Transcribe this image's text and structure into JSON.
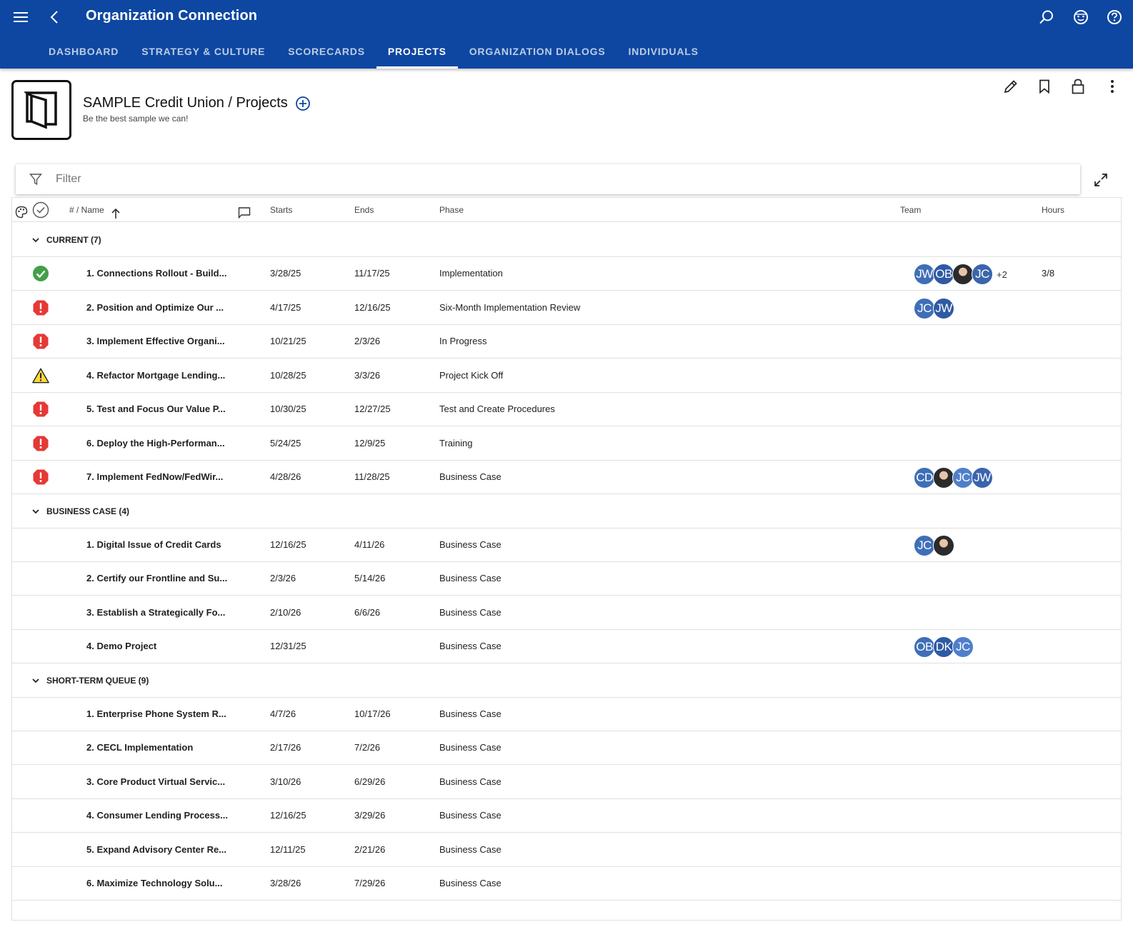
{
  "app": {
    "title": "Organization Connection",
    "brand_color": "#0d47a1",
    "tabs": [
      {
        "label": "DASHBOARD"
      },
      {
        "label": "STRATEGY & CULTURE"
      },
      {
        "label": "SCORECARDS"
      },
      {
        "label": "PROJECTS"
      },
      {
        "label": "ORGANIZATION DIALOGS"
      },
      {
        "label": "INDIVIDUALS"
      }
    ],
    "active_tab": "PROJECTS"
  },
  "header": {
    "title": "SAMPLE Credit Union / Projects",
    "subtitle": "Be the best sample we can!"
  },
  "filter": {
    "placeholder": "Filter"
  },
  "table": {
    "columns": {
      "name": "# / Name",
      "starts": "Starts",
      "ends": "Ends",
      "phase": "Phase",
      "team": "Team",
      "hours": "Hours"
    },
    "groups": [
      {
        "label": "CURRENT (7)",
        "rows": [
          {
            "status": "on-track",
            "name": "1. Connections Rollout - Build...",
            "starts": "3/28/25",
            "ends": "11/17/25",
            "phase": "Implementation",
            "team": [
              "JW",
              "OB",
              "photo",
              "JC"
            ],
            "team_more": "+2",
            "hours": "3/8"
          },
          {
            "status": "critical",
            "name": "2. Position and Optimize Our ...",
            "starts": "4/17/25",
            "ends": "12/16/25",
            "phase": "Six-Month Implementation Review",
            "team": [
              "JC",
              "JW"
            ],
            "team_more": "",
            "hours": ""
          },
          {
            "status": "critical",
            "name": "3. Implement Effective Organi...",
            "starts": "10/21/25",
            "ends": "2/3/26",
            "phase": "In Progress",
            "team": [],
            "team_more": "",
            "hours": ""
          },
          {
            "status": "warning",
            "name": "4. Refactor Mortgage Lending...",
            "starts": "10/28/25",
            "ends": "3/3/26",
            "phase": "Project Kick Off",
            "team": [],
            "team_more": "",
            "hours": ""
          },
          {
            "status": "critical",
            "name": "5. Test and Focus Our Value P...",
            "starts": "10/30/25",
            "ends": "12/27/25",
            "phase": "Test and Create Procedures",
            "team": [],
            "team_more": "",
            "hours": ""
          },
          {
            "status": "critical",
            "name": "6. Deploy the High-Performan...",
            "starts": "5/24/25",
            "ends": "12/9/25",
            "phase": "Training",
            "team": [],
            "team_more": "",
            "hours": ""
          },
          {
            "status": "critical",
            "name": "7. Implement FedNow/FedWir...",
            "starts": "4/28/26",
            "ends": "11/28/25",
            "phase": "Business Case",
            "team": [
              "CD",
              "photo",
              "JC",
              "JW"
            ],
            "team_more": "",
            "hours": ""
          }
        ]
      },
      {
        "label": "BUSINESS CASE (4)",
        "rows": [
          {
            "status": "",
            "name": "1. Digital Issue of Credit Cards",
            "starts": "12/16/25",
            "ends": "4/11/26",
            "phase": "Business Case",
            "team": [
              "JC",
              "photo"
            ],
            "team_more": "",
            "hours": ""
          },
          {
            "status": "",
            "name": "2. Certify our Frontline and Su...",
            "starts": "2/3/26",
            "ends": "5/14/26",
            "phase": "Business Case",
            "team": [],
            "team_more": "",
            "hours": ""
          },
          {
            "status": "",
            "name": "3. Establish a Strategically Fo...",
            "starts": "2/10/26",
            "ends": "6/6/26",
            "phase": "Business Case",
            "team": [],
            "team_more": "",
            "hours": ""
          },
          {
            "status": "",
            "name": "4. Demo Project",
            "starts": "12/31/25",
            "ends": "",
            "phase": "Business Case",
            "team": [
              "OB",
              "DK",
              "JC"
            ],
            "team_more": "",
            "hours": ""
          }
        ]
      },
      {
        "label": "SHORT-TERM QUEUE (9)",
        "rows": [
          {
            "status": "",
            "name": "1. Enterprise Phone System R...",
            "starts": "4/7/26",
            "ends": "10/17/26",
            "phase": "Business Case",
            "team": [],
            "team_more": "",
            "hours": ""
          },
          {
            "status": "",
            "name": "2. CECL Implementation",
            "starts": "2/17/26",
            "ends": "7/2/26",
            "phase": "Business Case",
            "team": [],
            "team_more": "",
            "hours": ""
          },
          {
            "status": "",
            "name": "3. Core Product Virtual Servic...",
            "starts": "3/10/26",
            "ends": "6/29/26",
            "phase": "Business Case",
            "team": [],
            "team_more": "",
            "hours": ""
          },
          {
            "status": "",
            "name": "4. Consumer Lending Process...",
            "starts": "12/16/25",
            "ends": "3/29/26",
            "phase": "Business Case",
            "team": [],
            "team_more": "",
            "hours": ""
          },
          {
            "status": "",
            "name": "5. Expand Advisory Center Re...",
            "starts": "12/11/25",
            "ends": "2/21/26",
            "phase": "Business Case",
            "team": [],
            "team_more": "",
            "hours": ""
          },
          {
            "status": "",
            "name": "6. Maximize Technology Solu...",
            "starts": "3/28/26",
            "ends": "7/29/26",
            "phase": "Business Case",
            "team": [],
            "team_more": "",
            "hours": ""
          }
        ]
      }
    ]
  },
  "colors": {
    "on_track": "#43a047",
    "critical": "#e53935",
    "warning": "#fdd835",
    "avatar_palette": [
      "#3f6eb8",
      "#2f5aa3",
      "#4f7fcb",
      "#3a65ad"
    ]
  }
}
